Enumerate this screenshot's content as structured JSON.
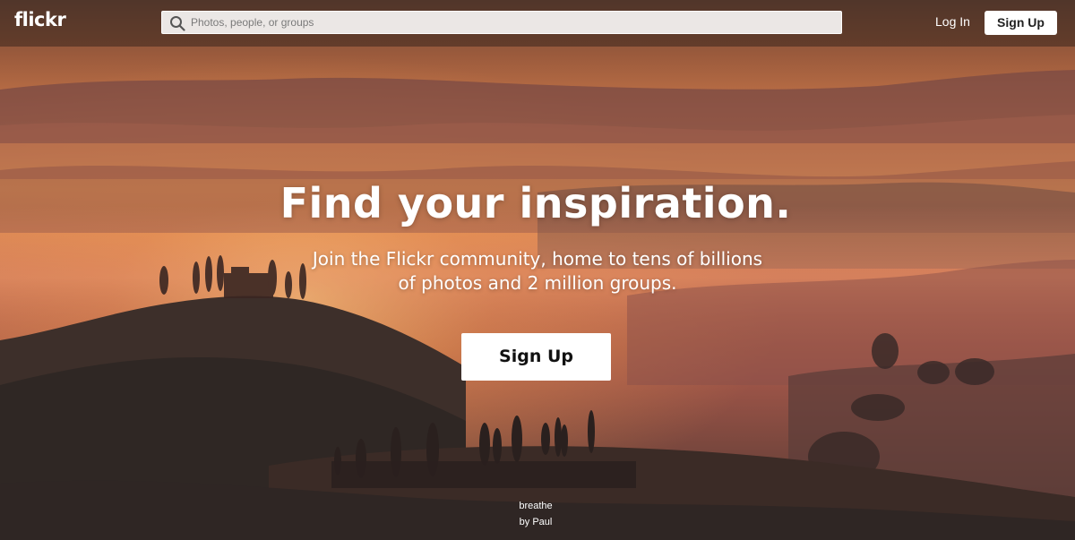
{
  "header": {
    "logo": "flickr",
    "search_placeholder": "Photos, people, or groups",
    "login_label": "Log In",
    "signup_label": "Sign Up"
  },
  "hero": {
    "title": "Find your inspiration.",
    "subtitle": "Join the Flickr community, home to tens of billions of photos and 2 million groups.",
    "signup_label": "Sign Up"
  },
  "photo_credit": {
    "title": "breathe",
    "author": "by Paul"
  },
  "icons": {
    "search": "search-icon"
  },
  "colors": {
    "sky_top": "#6b4a3a",
    "glow": "#f2a24e",
    "haze": "#d9745a",
    "hills_dark": "#3b2b24",
    "button_bg": "#ffffff"
  }
}
